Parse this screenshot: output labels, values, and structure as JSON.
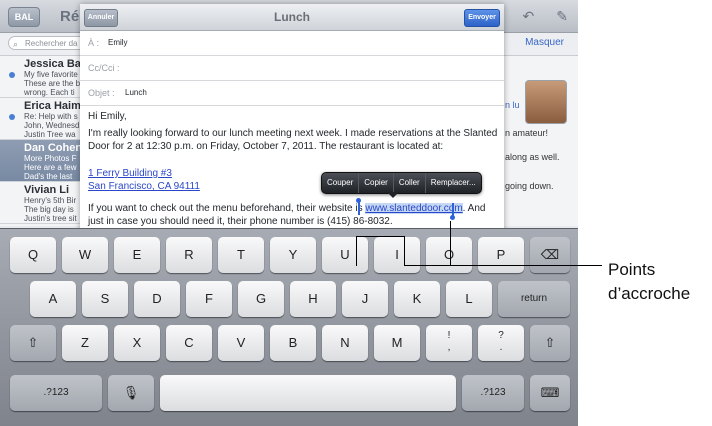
{
  "mail": {
    "back_label": "BAL",
    "bg_title": "Ré",
    "search_placeholder": "Rechercher da",
    "masquer": "Masquer",
    "messages": [
      {
        "name": "Jessica Ba",
        "preview1": "My five favorite",
        "preview2": "These are the b",
        "preview3": "wrong. Each ti",
        "unread": true
      },
      {
        "name": "Erica Haim",
        "preview1": "Re: Help with s",
        "preview2": "John, Wednesd",
        "preview3": "Justin Tree wa",
        "unread": true
      },
      {
        "name": "Dan Cohen",
        "preview1": "More Photos F",
        "preview2": "Here are a few",
        "preview3": "Dad's the last",
        "unread": false
      },
      {
        "name": "Vivian Li",
        "preview1": "Henry's 5th Bir",
        "preview2": "The big day is",
        "preview3": "Justin's tree sit",
        "unread": false
      }
    ],
    "pane": {
      "line1": "n lu",
      "line2": "n amateur!",
      "line3": "along as well.",
      "line4": "going down."
    }
  },
  "compose": {
    "cancel_label": "Annuler",
    "title": "Lunch",
    "send_label": "Envoyer",
    "to_label": "À :",
    "to_value": "Emily",
    "cc_label": "Cc/Cci :",
    "subject_label": "Objet :",
    "subject_value": "Lunch",
    "greeting": "Hi Emily,",
    "para1": "I'm really looking forward to our lunch meeting next week. I made reservations at the Slanted Door for 2 at 12:30 p.m. on Friday, October 7, 2011. The restaurant is located at:",
    "address1": "1 Ferry Building #3",
    "address2": "San Francisco, CA 94111",
    "para2_before": "If you want to check out the menu beforehand, their website is ",
    "para2_link": "www.slanteddoor.com",
    "para2_after": ". And",
    "para3_before": "just in case you should need it, their phone number is (415) 86",
    "para3_after": "-8032."
  },
  "edit_menu": [
    "Couper",
    "Copier",
    "Coller",
    "Remplacer..."
  ],
  "keyboard": {
    "row1": [
      "Q",
      "W",
      "E",
      "R",
      "T",
      "Y",
      "U",
      "I",
      "O",
      "P"
    ],
    "row2": [
      "A",
      "S",
      "D",
      "F",
      "G",
      "H",
      "J",
      "K",
      "L"
    ],
    "row3": [
      "Z",
      "X",
      "C",
      "V",
      "B",
      "N",
      "M"
    ],
    "return_label": "return",
    "numbers_label": ".?123",
    "excl_top": "!",
    "excl_bot": ",",
    "q_top": "?",
    "q_bot": "."
  },
  "callout": {
    "line1": "Points",
    "line2": "d’accroche"
  },
  "icons": {
    "back": "back-arrow-icon",
    "compose": "compose-icon",
    "search": "search-icon",
    "shift": "shift-icon",
    "delete": "delete-icon",
    "mic": "microphone-icon",
    "hide_keyboard": "keyboard-hide-icon"
  }
}
